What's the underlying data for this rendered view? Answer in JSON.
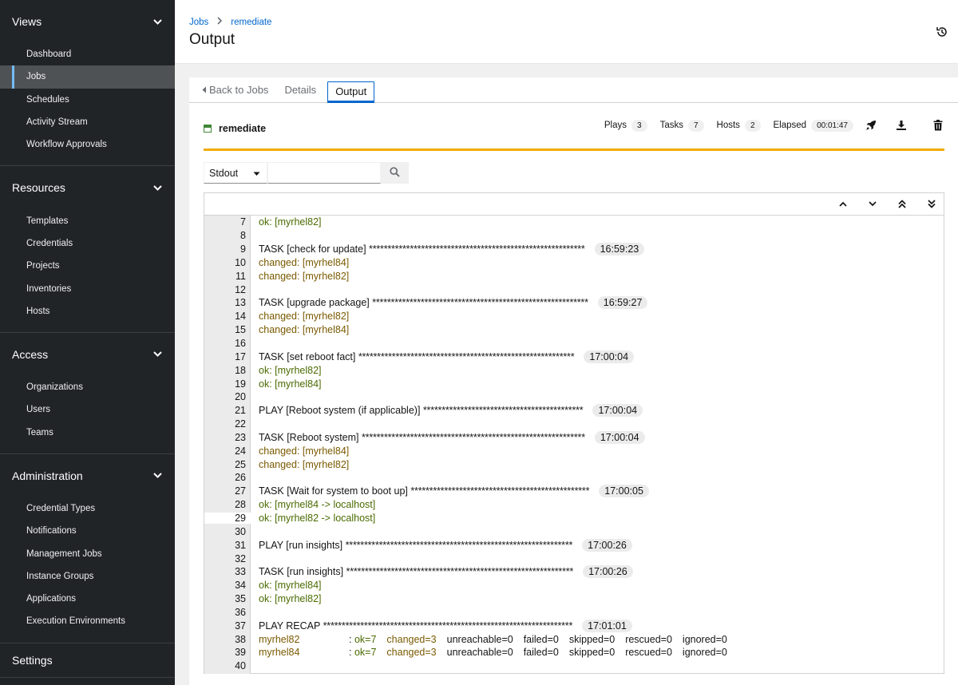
{
  "sidebar": {
    "sections": [
      {
        "title": "Views",
        "items": [
          "Dashboard",
          "Jobs",
          "Schedules",
          "Activity Stream",
          "Workflow Approvals"
        ]
      },
      {
        "title": "Resources",
        "items": [
          "Templates",
          "Credentials",
          "Projects",
          "Inventories",
          "Hosts"
        ]
      },
      {
        "title": "Access",
        "items": [
          "Organizations",
          "Users",
          "Teams"
        ]
      },
      {
        "title": "Administration",
        "items": [
          "Credential Types",
          "Notifications",
          "Management Jobs",
          "Instance Groups",
          "Applications",
          "Execution Environments"
        ]
      }
    ],
    "settings_label": "Settings",
    "active_item": "Jobs"
  },
  "header": {
    "breadcrumb": [
      "Jobs",
      "remediate"
    ],
    "title": "Output"
  },
  "tabs": {
    "back": "Back to Jobs",
    "details": "Details",
    "output": "Output"
  },
  "job": {
    "name": "remediate",
    "plays_label": "Plays",
    "plays": "3",
    "tasks_label": "Tasks",
    "tasks": "7",
    "hosts_label": "Hosts",
    "hosts": "2",
    "elapsed_label": "Elapsed",
    "elapsed": "00:01:47",
    "progress_color": "#f0ab00"
  },
  "filter": {
    "select_value": "Stdout",
    "input_value": ""
  },
  "output_lines": [
    {
      "n": "7",
      "kind": "ok",
      "text": "ok: [myrhel82]"
    },
    {
      "n": "8",
      "kind": "blank",
      "text": ""
    },
    {
      "n": "9",
      "kind": "task",
      "text": "TASK [check for update] ",
      "stars": "**********************************************************",
      "ts": "16:59:23"
    },
    {
      "n": "10",
      "kind": "changed",
      "text": "changed: [myrhel84]"
    },
    {
      "n": "11",
      "kind": "changed",
      "text": "changed: [myrhel82]"
    },
    {
      "n": "12",
      "kind": "blank",
      "text": ""
    },
    {
      "n": "13",
      "kind": "task",
      "text": "TASK [upgrade package] ",
      "stars": "**********************************************************",
      "ts": "16:59:27"
    },
    {
      "n": "14",
      "kind": "changed",
      "text": "changed: [myrhel82]"
    },
    {
      "n": "15",
      "kind": "changed",
      "text": "changed: [myrhel84]"
    },
    {
      "n": "16",
      "kind": "blank",
      "text": ""
    },
    {
      "n": "17",
      "kind": "task",
      "text": "TASK [set reboot fact] ",
      "stars": "**********************************************************",
      "ts": "17:00:04"
    },
    {
      "n": "18",
      "kind": "ok",
      "text": "ok: [myrhel82]"
    },
    {
      "n": "19",
      "kind": "ok",
      "text": "ok: [myrhel84]"
    },
    {
      "n": "20",
      "kind": "blank",
      "text": ""
    },
    {
      "n": "21",
      "kind": "task",
      "text": "PLAY [Reboot system (if applicable)] ",
      "stars": "*******************************************",
      "ts": "17:00:04"
    },
    {
      "n": "22",
      "kind": "blank",
      "text": ""
    },
    {
      "n": "23",
      "kind": "task",
      "text": "TASK [Reboot system] ",
      "stars": "************************************************************",
      "ts": "17:00:04"
    },
    {
      "n": "24",
      "kind": "changed",
      "text": "changed: [myrhel84]"
    },
    {
      "n": "25",
      "kind": "changed",
      "text": "changed: [myrhel82]"
    },
    {
      "n": "26",
      "kind": "blank",
      "text": ""
    },
    {
      "n": "27",
      "kind": "task",
      "text": "TASK [Wait for system to boot up] ",
      "stars": "************************************************",
      "ts": "17:00:05"
    },
    {
      "n": "28",
      "kind": "ok",
      "text": "ok: [myrhel84 -> localhost]"
    },
    {
      "n": "29",
      "kind": "ok",
      "text": "ok: [myrhel82 -> localhost]",
      "highlight": true
    },
    {
      "n": "30",
      "kind": "blank",
      "text": ""
    },
    {
      "n": "31",
      "kind": "task",
      "text": "PLAY [run insights] ",
      "stars": "*************************************************************",
      "ts": "17:00:26"
    },
    {
      "n": "32",
      "kind": "blank",
      "text": ""
    },
    {
      "n": "33",
      "kind": "task",
      "text": "TASK [run insights] ",
      "stars": "*************************************************************",
      "ts": "17:00:26"
    },
    {
      "n": "34",
      "kind": "ok",
      "text": "ok: [myrhel84]"
    },
    {
      "n": "35",
      "kind": "ok",
      "text": "ok: [myrhel82]"
    },
    {
      "n": "36",
      "kind": "blank",
      "text": ""
    },
    {
      "n": "37",
      "kind": "task",
      "text": "PLAY RECAP ",
      "stars": "*******************************************************************",
      "ts": "17:01:01"
    },
    {
      "n": "38",
      "kind": "recap",
      "host": "myrhel82",
      "ok": ": ok=7",
      "changed": "changed=3",
      "rest": [
        "unreachable=0",
        "failed=0",
        "skipped=0",
        "rescued=0",
        "ignored=0"
      ]
    },
    {
      "n": "39",
      "kind": "recap",
      "host": "myrhel84",
      "ok": ": ok=7",
      "changed": "changed=3",
      "rest": [
        "unreachable=0",
        "failed=0",
        "skipped=0",
        "rescued=0",
        "ignored=0"
      ]
    },
    {
      "n": "40",
      "kind": "blank",
      "text": ""
    }
  ]
}
